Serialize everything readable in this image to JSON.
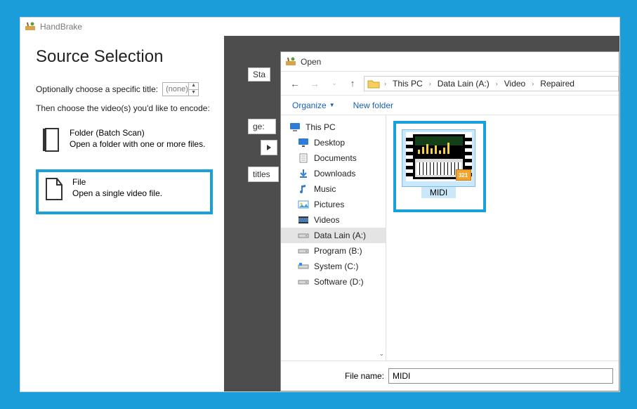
{
  "app": {
    "title": "HandBrake"
  },
  "sourceSelection": {
    "heading": "Source Selection",
    "chooseTitleLabel": "Optionally choose a specific title:",
    "titleSpinner": "(none)",
    "thenChoose": "Then choose the video(s) you'd like to encode:",
    "folder": {
      "name": "Folder (Batch Scan)",
      "desc": "Open a folder with one or more files."
    },
    "file": {
      "name": "File",
      "desc": "Open a single video file."
    }
  },
  "backgroundFragments": {
    "sta": "Sta",
    "ge": "ge:",
    "titles": "titles"
  },
  "openDialog": {
    "title": "Open",
    "breadcrumb": [
      "This PC",
      "Data Lain (A:)",
      "Video",
      "Repaired"
    ],
    "toolbar": {
      "organize": "Organize",
      "newFolder": "New folder"
    },
    "tree": [
      {
        "label": "This PC",
        "icon": "pc",
        "indent": false
      },
      {
        "label": "Desktop",
        "icon": "desktop",
        "indent": true
      },
      {
        "label": "Documents",
        "icon": "doc",
        "indent": true
      },
      {
        "label": "Downloads",
        "icon": "down",
        "indent": true
      },
      {
        "label": "Music",
        "icon": "music",
        "indent": true
      },
      {
        "label": "Pictures",
        "icon": "pic",
        "indent": true
      },
      {
        "label": "Videos",
        "icon": "vid",
        "indent": true
      },
      {
        "label": "Data Lain (A:)",
        "icon": "drive",
        "indent": true,
        "selected": true
      },
      {
        "label": "Program (B:)",
        "icon": "drive",
        "indent": true
      },
      {
        "label": "System (C:)",
        "icon": "drivesys",
        "indent": true
      },
      {
        "label": "Software (D:)",
        "icon": "drive",
        "indent": true
      }
    ],
    "file": {
      "name": "MIDI",
      "badge": "321"
    },
    "fileNameLabel": "File name:",
    "fileNameValue": "MIDI"
  }
}
